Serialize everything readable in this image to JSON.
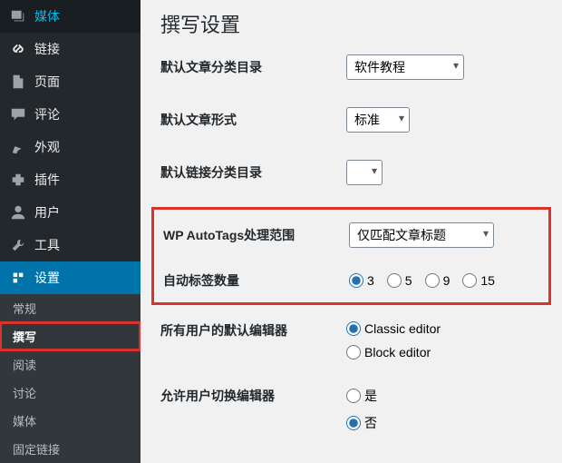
{
  "sidebar": {
    "items": [
      {
        "label": "媒体",
        "icon": "media-icon"
      },
      {
        "label": "链接",
        "icon": "link-icon"
      },
      {
        "label": "页面",
        "icon": "page-icon"
      },
      {
        "label": "评论",
        "icon": "comment-icon"
      },
      {
        "label": "外观",
        "icon": "appearance-icon"
      },
      {
        "label": "插件",
        "icon": "plugin-icon"
      },
      {
        "label": "用户",
        "icon": "user-icon"
      },
      {
        "label": "工具",
        "icon": "tool-icon"
      },
      {
        "label": "设置",
        "icon": "settings-icon"
      }
    ],
    "sub": [
      {
        "label": "常规"
      },
      {
        "label": "撰写"
      },
      {
        "label": "阅读"
      },
      {
        "label": "讨论"
      },
      {
        "label": "媒体"
      },
      {
        "label": "固定链接"
      }
    ]
  },
  "page": {
    "title": "撰写设置"
  },
  "form": {
    "default_category": {
      "label": "默认文章分类目录",
      "value": "软件教程"
    },
    "default_format": {
      "label": "默认文章形式",
      "value": "标准"
    },
    "default_link_category": {
      "label": "默认链接分类目录",
      "value": " "
    },
    "autotags_scope": {
      "label": "WP AutoTags处理范围",
      "value": "仅匹配文章标题"
    },
    "tag_count": {
      "label": "自动标签数量",
      "options": [
        "3",
        "5",
        "9",
        "15"
      ],
      "selected": "3"
    },
    "default_editor": {
      "label": "所有用户的默认编辑器",
      "options": [
        "Classic editor",
        "Block editor"
      ],
      "selected": "Classic editor"
    },
    "allow_switch": {
      "label": "允许用户切换编辑器",
      "options": [
        "是",
        "否"
      ],
      "selected": "否"
    }
  }
}
